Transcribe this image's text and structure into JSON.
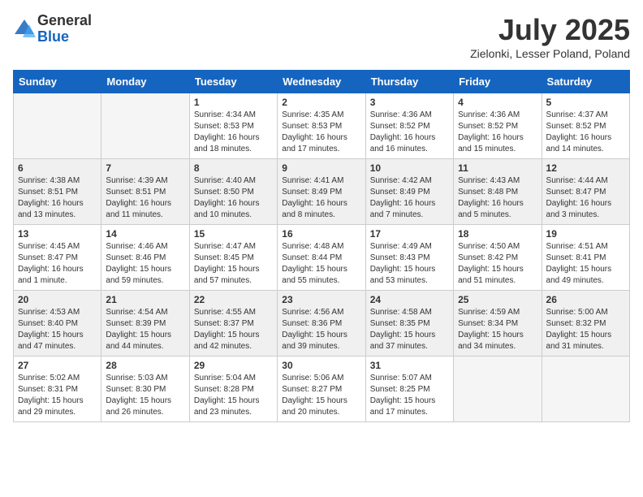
{
  "header": {
    "logo_general": "General",
    "logo_blue": "Blue",
    "month_year": "July 2025",
    "location": "Zielonki, Lesser Poland, Poland"
  },
  "weekdays": [
    "Sunday",
    "Monday",
    "Tuesday",
    "Wednesday",
    "Thursday",
    "Friday",
    "Saturday"
  ],
  "weeks": [
    [
      {
        "day": "",
        "info": ""
      },
      {
        "day": "",
        "info": ""
      },
      {
        "day": "1",
        "info": "Sunrise: 4:34 AM\nSunset: 8:53 PM\nDaylight: 16 hours\nand 18 minutes."
      },
      {
        "day": "2",
        "info": "Sunrise: 4:35 AM\nSunset: 8:53 PM\nDaylight: 16 hours\nand 17 minutes."
      },
      {
        "day": "3",
        "info": "Sunrise: 4:36 AM\nSunset: 8:52 PM\nDaylight: 16 hours\nand 16 minutes."
      },
      {
        "day": "4",
        "info": "Sunrise: 4:36 AM\nSunset: 8:52 PM\nDaylight: 16 hours\nand 15 minutes."
      },
      {
        "day": "5",
        "info": "Sunrise: 4:37 AM\nSunset: 8:52 PM\nDaylight: 16 hours\nand 14 minutes."
      }
    ],
    [
      {
        "day": "6",
        "info": "Sunrise: 4:38 AM\nSunset: 8:51 PM\nDaylight: 16 hours\nand 13 minutes."
      },
      {
        "day": "7",
        "info": "Sunrise: 4:39 AM\nSunset: 8:51 PM\nDaylight: 16 hours\nand 11 minutes."
      },
      {
        "day": "8",
        "info": "Sunrise: 4:40 AM\nSunset: 8:50 PM\nDaylight: 16 hours\nand 10 minutes."
      },
      {
        "day": "9",
        "info": "Sunrise: 4:41 AM\nSunset: 8:49 PM\nDaylight: 16 hours\nand 8 minutes."
      },
      {
        "day": "10",
        "info": "Sunrise: 4:42 AM\nSunset: 8:49 PM\nDaylight: 16 hours\nand 7 minutes."
      },
      {
        "day": "11",
        "info": "Sunrise: 4:43 AM\nSunset: 8:48 PM\nDaylight: 16 hours\nand 5 minutes."
      },
      {
        "day": "12",
        "info": "Sunrise: 4:44 AM\nSunset: 8:47 PM\nDaylight: 16 hours\nand 3 minutes."
      }
    ],
    [
      {
        "day": "13",
        "info": "Sunrise: 4:45 AM\nSunset: 8:47 PM\nDaylight: 16 hours\nand 1 minute."
      },
      {
        "day": "14",
        "info": "Sunrise: 4:46 AM\nSunset: 8:46 PM\nDaylight: 15 hours\nand 59 minutes."
      },
      {
        "day": "15",
        "info": "Sunrise: 4:47 AM\nSunset: 8:45 PM\nDaylight: 15 hours\nand 57 minutes."
      },
      {
        "day": "16",
        "info": "Sunrise: 4:48 AM\nSunset: 8:44 PM\nDaylight: 15 hours\nand 55 minutes."
      },
      {
        "day": "17",
        "info": "Sunrise: 4:49 AM\nSunset: 8:43 PM\nDaylight: 15 hours\nand 53 minutes."
      },
      {
        "day": "18",
        "info": "Sunrise: 4:50 AM\nSunset: 8:42 PM\nDaylight: 15 hours\nand 51 minutes."
      },
      {
        "day": "19",
        "info": "Sunrise: 4:51 AM\nSunset: 8:41 PM\nDaylight: 15 hours\nand 49 minutes."
      }
    ],
    [
      {
        "day": "20",
        "info": "Sunrise: 4:53 AM\nSunset: 8:40 PM\nDaylight: 15 hours\nand 47 minutes."
      },
      {
        "day": "21",
        "info": "Sunrise: 4:54 AM\nSunset: 8:39 PM\nDaylight: 15 hours\nand 44 minutes."
      },
      {
        "day": "22",
        "info": "Sunrise: 4:55 AM\nSunset: 8:37 PM\nDaylight: 15 hours\nand 42 minutes."
      },
      {
        "day": "23",
        "info": "Sunrise: 4:56 AM\nSunset: 8:36 PM\nDaylight: 15 hours\nand 39 minutes."
      },
      {
        "day": "24",
        "info": "Sunrise: 4:58 AM\nSunset: 8:35 PM\nDaylight: 15 hours\nand 37 minutes."
      },
      {
        "day": "25",
        "info": "Sunrise: 4:59 AM\nSunset: 8:34 PM\nDaylight: 15 hours\nand 34 minutes."
      },
      {
        "day": "26",
        "info": "Sunrise: 5:00 AM\nSunset: 8:32 PM\nDaylight: 15 hours\nand 31 minutes."
      }
    ],
    [
      {
        "day": "27",
        "info": "Sunrise: 5:02 AM\nSunset: 8:31 PM\nDaylight: 15 hours\nand 29 minutes."
      },
      {
        "day": "28",
        "info": "Sunrise: 5:03 AM\nSunset: 8:30 PM\nDaylight: 15 hours\nand 26 minutes."
      },
      {
        "day": "29",
        "info": "Sunrise: 5:04 AM\nSunset: 8:28 PM\nDaylight: 15 hours\nand 23 minutes."
      },
      {
        "day": "30",
        "info": "Sunrise: 5:06 AM\nSunset: 8:27 PM\nDaylight: 15 hours\nand 20 minutes."
      },
      {
        "day": "31",
        "info": "Sunrise: 5:07 AM\nSunset: 8:25 PM\nDaylight: 15 hours\nand 17 minutes."
      },
      {
        "day": "",
        "info": ""
      },
      {
        "day": "",
        "info": ""
      }
    ]
  ]
}
